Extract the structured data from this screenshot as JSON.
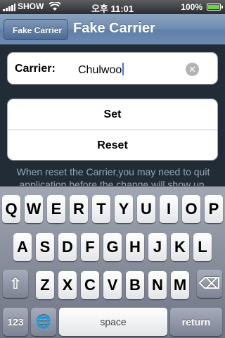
{
  "status": {
    "carrier": "SHOW",
    "time": "오후 11:01",
    "battery": "100%"
  },
  "nav": {
    "back_label": "Fake Carrier",
    "title": "Fake Carrier"
  },
  "form": {
    "label": "Carrier:",
    "value": "Chulwoo",
    "clear_icon": "clear-icon"
  },
  "buttons": {
    "set": "Set",
    "reset": "Reset"
  },
  "note": "When reset the Carrier,you may need to quit application before the change will show up.",
  "keyboard": {
    "row1": [
      "Q",
      "W",
      "E",
      "R",
      "T",
      "Y",
      "U",
      "I",
      "O",
      "P"
    ],
    "row2": [
      "A",
      "S",
      "D",
      "F",
      "G",
      "H",
      "J",
      "K",
      "L"
    ],
    "row3": [
      "Z",
      "X",
      "C",
      "V",
      "B",
      "N",
      "M"
    ],
    "numbers": "123",
    "space": "space",
    "return": "return"
  }
}
